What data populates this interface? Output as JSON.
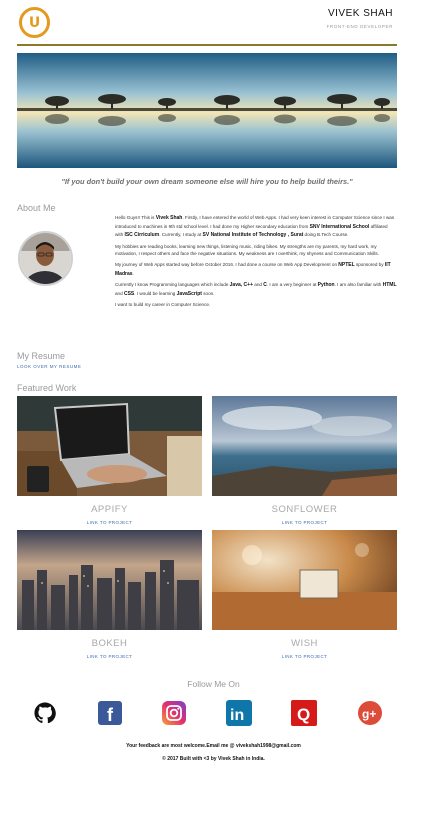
{
  "header": {
    "logo_letter": "U",
    "name": "VIVEK SHAH",
    "subtitle": "FRONT-END DEVELOPER"
  },
  "quote": "\"If you don't build your own dream someone else will hire you to help build theirs.\"",
  "about": {
    "title": "About Me",
    "p1_intro": "Hello Guys!! This is ",
    "p1_name": "Vivek Shah",
    "p1_mid": ". Firstly, I have entered the world of Web Apps. I had very keen interest in Computer Science since I was introduced to machines in 9th std school level. I had done my Higher secondary education from ",
    "p1_school": "SNV International School",
    "p1_mid2": " affiliated with ",
    "p1_board": "ISC Cirriculum",
    "p1_mid3": ". Currently, I study at ",
    "p1_college": "SV National Institute of Technology , Surat",
    "p1_end": " doing B.Tech Course.",
    "p2": "My hobbies are reading books, learning new things, listening music, riding bikes. My strengths are my parents, my hard work, my motivation, I respect others and face the negative situations. My weakness are I overthink, my shyness and Communication Skills.",
    "p3_start": "My journey of Web Apps started way before October 2016. I had done a course on Web App Development on ",
    "p3_platform": "NPTEL",
    "p3_mid": " sponsored by ",
    "p3_inst": "IIT Madras",
    "p3_end": ".",
    "p4_start": "Currently I know Programming languages which include ",
    "p4_langs": "Java, C++",
    "p4_and": " and ",
    "p4_c": "C",
    "p4_mid": ". I am a very beginner at ",
    "p4_python": "Python",
    "p4_mid2": ". I am also familiar with ",
    "p4_html": "HTML",
    "p4_and2": " and ",
    "p4_css": "CSS",
    "p4_mid3": ". I would be learning ",
    "p4_js": "JavaScript",
    "p4_end": " soon.",
    "p5": "I want to build my career in Computer Science."
  },
  "resume": {
    "title": "My Resume",
    "link": "LOOK OVER MY RESUME"
  },
  "featured": {
    "title": "Featured Work",
    "items": [
      {
        "title": "APPIFY",
        "link": "LINK TO PROJECT"
      },
      {
        "title": "SONFLOWER",
        "link": "LINK TO PROJECT"
      },
      {
        "title": "BOKEH",
        "link": "LINK TO PROJECT"
      },
      {
        "title": "WISH",
        "link": "LINK TO PROJECT"
      }
    ]
  },
  "follow": {
    "title": "Follow Me On",
    "icons": [
      "github-icon",
      "facebook-icon",
      "instagram-icon",
      "linkedin-icon",
      "quora-icon",
      "google-plus-icon"
    ],
    "facebook_letter": "f",
    "linkedin_letters": "in",
    "quora_letter": "Q",
    "gplus_letters": "g+"
  },
  "feedback": "Your feedback are most welcome.Email me @ vivekshah1998@gmail.com",
  "footer": "© 2017 Built with <3 by Vivek Shah in India.",
  "colors": {
    "accent_orange": "#e49a1e",
    "link_blue": "#3b6db3",
    "header_rule": "#8a7a2a"
  }
}
